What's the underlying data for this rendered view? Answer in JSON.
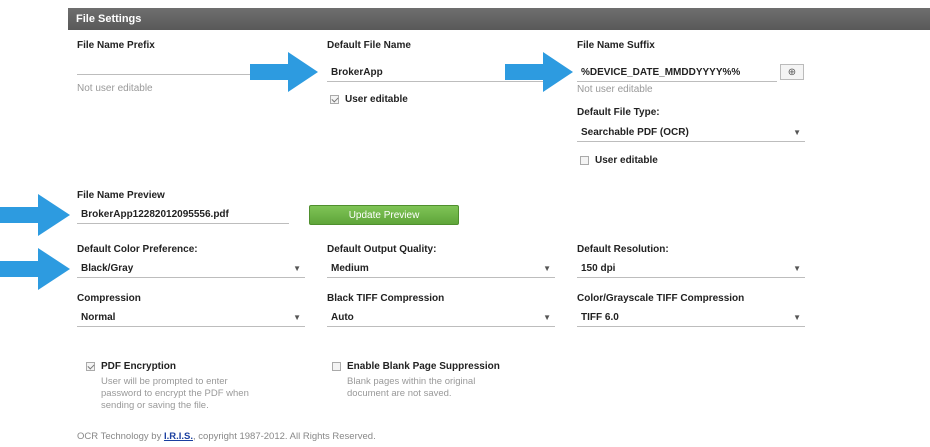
{
  "header": {
    "title": "File Settings"
  },
  "prefix": {
    "label": "File Name Prefix",
    "value": "",
    "note": "Not user editable"
  },
  "default_name": {
    "label": "Default File Name",
    "value": "BrokerApp",
    "editable_label": "User editable",
    "editable_checked": true
  },
  "suffix": {
    "label": "File Name Suffix",
    "value": "%DEVICE_DATE_MMDDYYYY%%",
    "add_button": "⊕",
    "note": "Not user editable"
  },
  "file_type": {
    "label": "Default File Type:",
    "value": "Searchable PDF (OCR)",
    "editable_label": "User editable",
    "editable_checked": false
  },
  "preview": {
    "label": "File Name Preview",
    "value": "BrokerApp12282012095556.pdf",
    "button": "Update Preview"
  },
  "color_pref": {
    "label": "Default Color Preference:",
    "value": "Black/Gray"
  },
  "output_quality": {
    "label": "Default Output Quality:",
    "value": "Medium"
  },
  "resolution": {
    "label": "Default Resolution:",
    "value": "150 dpi"
  },
  "compression": {
    "label": "Compression",
    "value": "Normal"
  },
  "black_tiff": {
    "label": "Black TIFF Compression",
    "value": "Auto"
  },
  "color_tiff": {
    "label": "Color/Grayscale TIFF Compression",
    "value": "TIFF 6.0"
  },
  "pdf_encryption": {
    "label": "PDF Encryption",
    "checked": true,
    "desc1": "User will be prompted to enter",
    "desc2": "password to encrypt the PDF when",
    "desc3": "sending or saving the file."
  },
  "blank_page": {
    "label": "Enable Blank Page Suppression",
    "checked": false,
    "desc1": "Blank pages within the original",
    "desc2": "document are not saved."
  },
  "footer": {
    "prefix": "OCR Technology by",
    "link": "I.R.I.S.",
    "suffix": "copyright 1987-2012. All Rights Reserved."
  },
  "colors": {
    "arrow": "#2d9be0",
    "header": "#626262",
    "button": "#6db547"
  },
  "icons": {
    "dropdown": "chevron-down-icon",
    "arrow": "arrow-right-icon"
  }
}
